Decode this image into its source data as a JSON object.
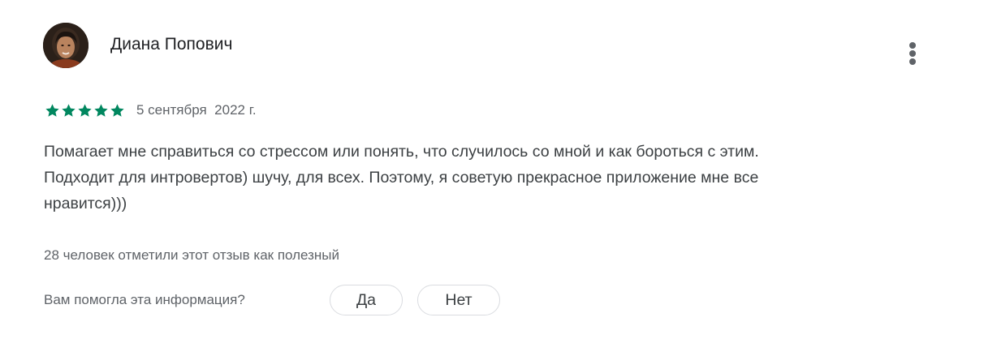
{
  "review": {
    "author": {
      "name": "Диана Попович",
      "avatar": "profile-photo"
    },
    "rating": {
      "stars": 5,
      "max": 5,
      "color": "#01875f"
    },
    "date": "5 сентября  2022 г.",
    "text": "Помагает мне справиться со стрессом или понять, что случилось со мной и как бороться с этим.\nПодходит для интровертов) шучу, для всех. Поэтому, я советую прекрасное приложение  мне все\nнравится)))",
    "helpful_count_text": "28 человек отметили этот отзыв как полезный",
    "feedback": {
      "question": "Вам помогла эта информация?",
      "yes_label": "Да",
      "no_label": "Нет"
    },
    "menu_icon": "more-vert-icon"
  }
}
